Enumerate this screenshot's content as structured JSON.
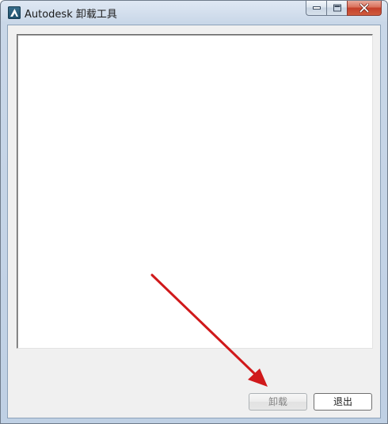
{
  "window": {
    "title": "Autodesk 卸载工具",
    "icon": "autodesk-logo-icon"
  },
  "caption_buttons": {
    "minimize_icon": "minimize-icon",
    "maximize_icon": "maximize-icon",
    "close_icon": "close-icon"
  },
  "listbox": {
    "items": []
  },
  "buttons": {
    "uninstall_label": "卸载",
    "exit_label": "退出"
  },
  "annotation": {
    "arrow_color": "#d0191b"
  }
}
